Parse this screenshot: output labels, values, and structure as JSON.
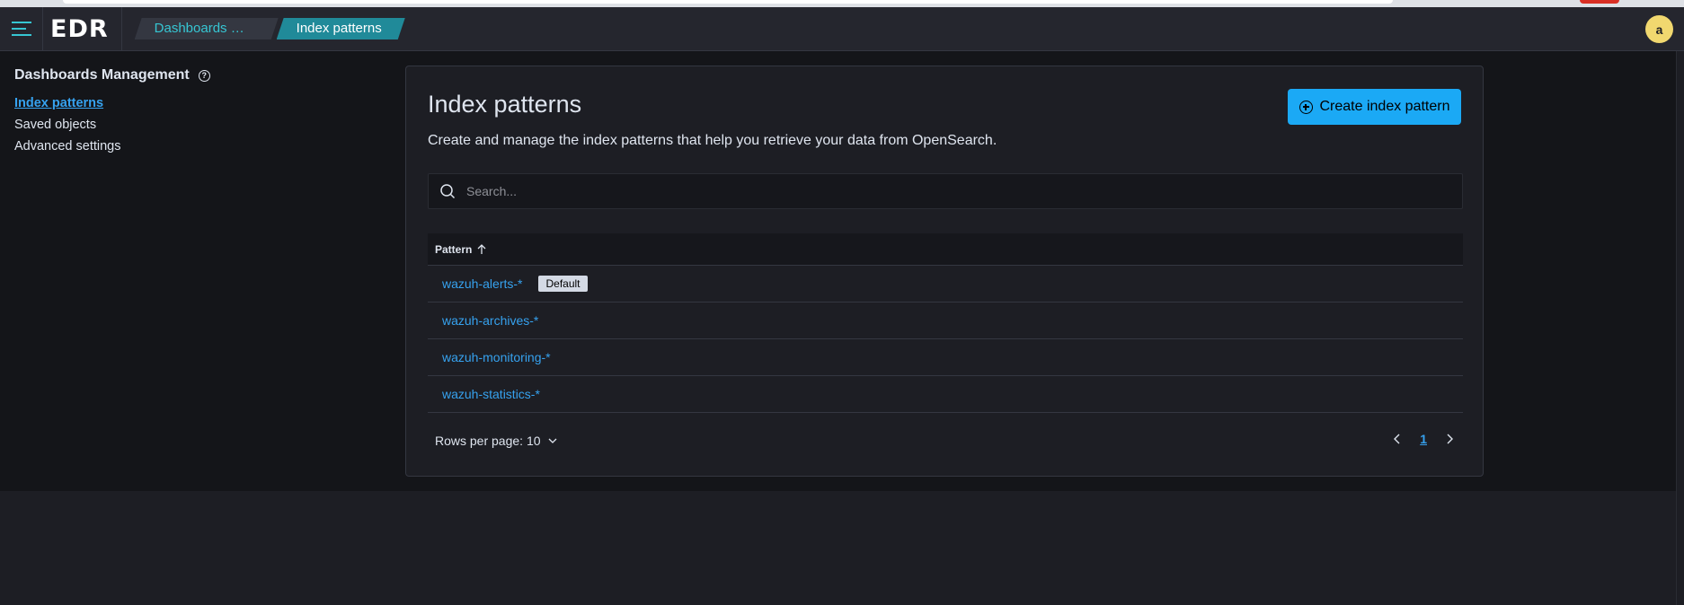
{
  "header": {
    "logo_text": "EDR",
    "breadcrumbs": [
      "Dashboards Man...",
      "Index patterns"
    ],
    "avatar_letter": "a"
  },
  "sidenav": {
    "title": "Dashboards Management",
    "items": [
      {
        "label": "Index patterns",
        "active": true
      },
      {
        "label": "Saved objects",
        "active": false
      },
      {
        "label": "Advanced settings",
        "active": false
      }
    ]
  },
  "main": {
    "title": "Index patterns",
    "description": "Create and manage the index patterns that help you retrieve your data from OpenSearch.",
    "create_button": "Create index pattern",
    "search_placeholder": "Search...",
    "table": {
      "column_header": "Pattern",
      "rows": [
        {
          "pattern": "wazuh-alerts-*",
          "badge": "Default"
        },
        {
          "pattern": "wazuh-archives-*"
        },
        {
          "pattern": "wazuh-monitoring-*"
        },
        {
          "pattern": "wazuh-statistics-*"
        }
      ]
    },
    "rows_per_page": "Rows per page: 10",
    "current_page": "1"
  },
  "colors": {
    "accent": "#1ba9f5",
    "link": "#36a2ef",
    "breadcrumb_active": "#208a99",
    "avatar": "#f1d86f"
  }
}
